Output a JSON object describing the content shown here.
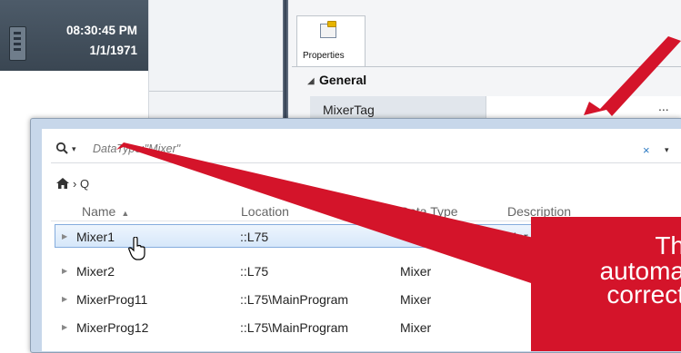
{
  "clock": {
    "time": "08:30:45 PM",
    "date": "1/1/1971"
  },
  "properties": {
    "tab_label": "Properties",
    "section": "General",
    "row_name": "MixerTag",
    "row_button": "..."
  },
  "browser": {
    "search_placeholder": "DataType:\"Mixer\"",
    "search_clear": "×",
    "search_dropdown": "▾",
    "breadcrumb": "› Q",
    "columns": [
      "Name",
      "Location",
      "Data Type",
      "Description"
    ],
    "rows": [
      {
        "name": "Mixer1",
        "location": "::L75",
        "type": "",
        "description": "Nor",
        "selected": true
      },
      {
        "name": "Mixer2",
        "location": "::L75",
        "type": "Mixer",
        "description": ""
      },
      {
        "name": "MixerProg11",
        "location": "::L75\\MainProgram",
        "type": "Mixer",
        "description": ""
      },
      {
        "name": "MixerProg12",
        "location": "::L75\\MainProgram",
        "type": "Mixer",
        "description": ""
      }
    ]
  },
  "callout": {
    "lines": [
      "Th",
      "automa",
      "correct"
    ]
  },
  "colors": {
    "annotation_red": "#d4142a",
    "selection_blue": "#84acdd"
  }
}
